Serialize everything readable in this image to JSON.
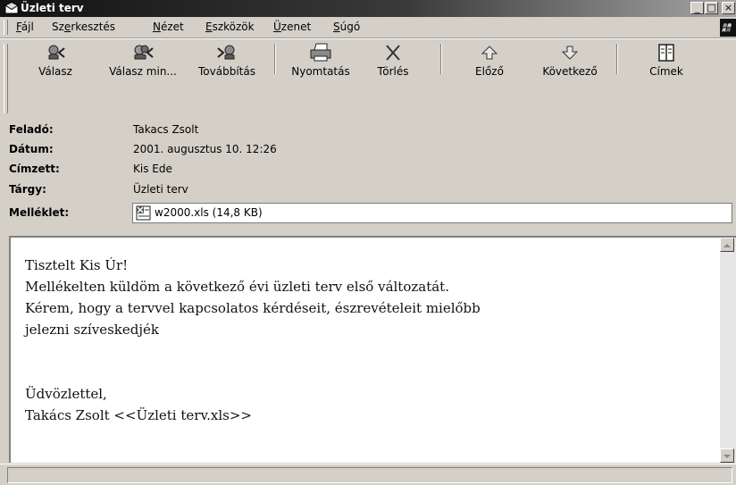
{
  "window": {
    "title": "Üzleti terv",
    "controls": [
      "_",
      "□",
      "×"
    ]
  },
  "menu": {
    "items": [
      {
        "pre": "",
        "acc": "F",
        "post": "ájl"
      },
      {
        "pre": "Sz",
        "acc": "e",
        "post": "rkesztés"
      },
      {
        "pre": "",
        "acc": "N",
        "post": "ézet"
      },
      {
        "pre": "",
        "acc": "E",
        "post": "szközök"
      },
      {
        "pre": "",
        "acc": "Ü",
        "post": "zenet"
      },
      {
        "pre": "",
        "acc": "S",
        "post": "úgó"
      }
    ]
  },
  "toolbar": {
    "buttons": [
      {
        "label": "Válasz",
        "icon": "reply-icon"
      },
      {
        "label": "Válasz min...",
        "icon": "reply-all-icon"
      },
      {
        "label": "Továbbítás",
        "icon": "forward-icon"
      },
      {
        "label": "Nyomtatás",
        "icon": "printer-icon"
      },
      {
        "label": "Törlés",
        "icon": "delete-icon"
      },
      {
        "label": "Előző",
        "icon": "previous-icon"
      },
      {
        "label": "Következő",
        "icon": "next-icon"
      },
      {
        "label": "Címek",
        "icon": "address-book-icon"
      }
    ]
  },
  "header": {
    "from_label": "Feladó:",
    "from_value": "Takacs Zsolt",
    "date_label": "Dátum:",
    "date_value": "2001. augusztus 10. 12:26",
    "to_label": "Címzett:",
    "to_value": "Kis Ede",
    "subject_label": "Tárgy:",
    "subject_value": "Üzleti terv",
    "attachment_label": "Melléklet:",
    "attachment_value": "w2000.xls (14,8 KB)"
  },
  "message": {
    "lines": [
      "Tisztelt Kis Úr!",
      "Mellékelten küldöm a következő évi üzleti terv első változatát.",
      "Kérem, hogy a tervvel kapcsolatos kérdéseit, észrevételeit mielőbb",
      "jelezni szíveskedjék",
      "Üdvözlettel,",
      "Takács Zsolt <<Üzleti terv.xls>>"
    ]
  },
  "colors": {
    "titlebar_dark": "#121212",
    "face": "#d4d0c8"
  }
}
